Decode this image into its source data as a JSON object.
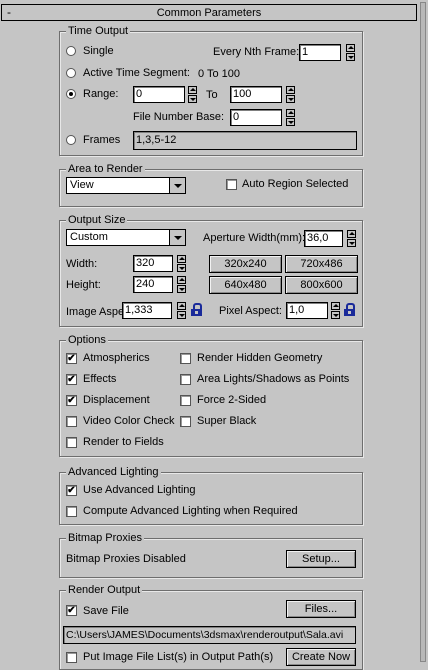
{
  "rollout": {
    "toggle": "-",
    "title": "Common Parameters"
  },
  "time_output": {
    "title": "Time Output",
    "single": "Single",
    "every_nth_label": "Every Nth Frame:",
    "every_nth_value": "1",
    "active_segment": "Active Time Segment:",
    "active_range": "0 To 100",
    "range": "Range:",
    "range_from": "0",
    "range_to_label": "To",
    "range_to": "100",
    "file_number_base_label": "File Number Base:",
    "file_number_base": "0",
    "frames": "Frames",
    "frames_value": "1,3,5-12",
    "selected": "range"
  },
  "area_to_render": {
    "title": "Area to Render",
    "view_option": "View",
    "auto_region": "Auto Region Selected",
    "auto_region_checked": false
  },
  "output_size": {
    "title": "Output Size",
    "preset": "Custom",
    "aperture_label": "Aperture Width(mm):",
    "aperture_value": "36,0",
    "width_label": "Width:",
    "width_value": "320",
    "height_label": "Height:",
    "height_value": "240",
    "presets": [
      "320x240",
      "720x486",
      "640x480",
      "800x600"
    ],
    "image_aspect_label": "Image Aspect:",
    "image_aspect_value": "1,333",
    "pixel_aspect_label": "Pixel Aspect:",
    "pixel_aspect_value": "1,0",
    "lock_icon": "lock-icon"
  },
  "options": {
    "title": "Options",
    "left": [
      {
        "label": "Atmospherics",
        "checked": true
      },
      {
        "label": "Effects",
        "checked": true
      },
      {
        "label": "Displacement",
        "checked": true
      },
      {
        "label": "Video Color Check",
        "checked": false
      },
      {
        "label": "Render to Fields",
        "checked": false
      }
    ],
    "right": [
      {
        "label": "Render Hidden Geometry",
        "checked": false
      },
      {
        "label": "Area Lights/Shadows as Points",
        "checked": false
      },
      {
        "label": "Force 2-Sided",
        "checked": false
      },
      {
        "label": "Super Black",
        "checked": false
      }
    ]
  },
  "advanced_lighting": {
    "title": "Advanced Lighting",
    "use": "Use Advanced Lighting",
    "use_checked": true,
    "compute": "Compute Advanced Lighting when Required",
    "compute_checked": false
  },
  "bitmap_proxies": {
    "title": "Bitmap Proxies",
    "status": "Bitmap Proxies Disabled",
    "setup": "Setup..."
  },
  "render_output": {
    "title": "Render Output",
    "save_file": "Save File",
    "save_file_checked": true,
    "files_button": "Files...",
    "path": "C:\\Users\\JAMES\\Documents\\3dsmax\\renderoutput\\Sala.avi",
    "put_image_list": "Put Image File List(s) in Output Path(s)",
    "create_now": "Create Now"
  },
  "check_mark": "✔"
}
